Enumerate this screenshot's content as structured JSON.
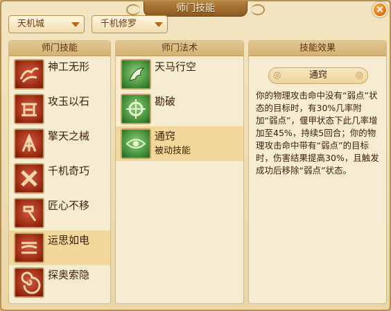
{
  "window": {
    "title": "师门技能",
    "close_label": "×"
  },
  "dropdowns": [
    {
      "value": "天机城"
    },
    {
      "value": "千机修罗"
    }
  ],
  "panels": {
    "skills": {
      "header": "师门技能",
      "items": [
        {
          "label": "神工无形",
          "icon": "wings-glyph-icon"
        },
        {
          "label": "攻玉以石",
          "icon": "tool-glyph-icon"
        },
        {
          "label": "擎天之械",
          "icon": "machine-glyph-icon"
        },
        {
          "label": "千机奇巧",
          "icon": "cross-blades-icon"
        },
        {
          "label": "匠心不移",
          "icon": "hammer-icon"
        },
        {
          "label": "运思如电",
          "icon": "spiral-scroll-icon",
          "selected": true
        },
        {
          "label": "探奥索隐",
          "icon": "vortex-icon"
        }
      ]
    },
    "spells": {
      "header": "师门法术",
      "items": [
        {
          "label": "天马行空",
          "icon": "wing-icon"
        },
        {
          "label": "勘破",
          "icon": "crosshair-icon"
        },
        {
          "label": "通窍",
          "sub": "被动技能",
          "icon": "eye-icon",
          "selected": true
        }
      ]
    },
    "effect": {
      "header": "技能效果",
      "name": "通窍",
      "description": "你的物理攻击命中没有“弱点”状态的目标时，有30%几率附加“弱点”，偃甲状态下此几率增加至45%，持续5回合；你的物理攻击命中带有“弱点”的目标时，伤害结果提高30%，且触发成功后移除“弱点”状态。"
    }
  },
  "colors": {
    "accent": "#b68f4c",
    "selected_row": "#f1d89a",
    "text": "#3a1f08",
    "close_button": "#e0781a"
  }
}
